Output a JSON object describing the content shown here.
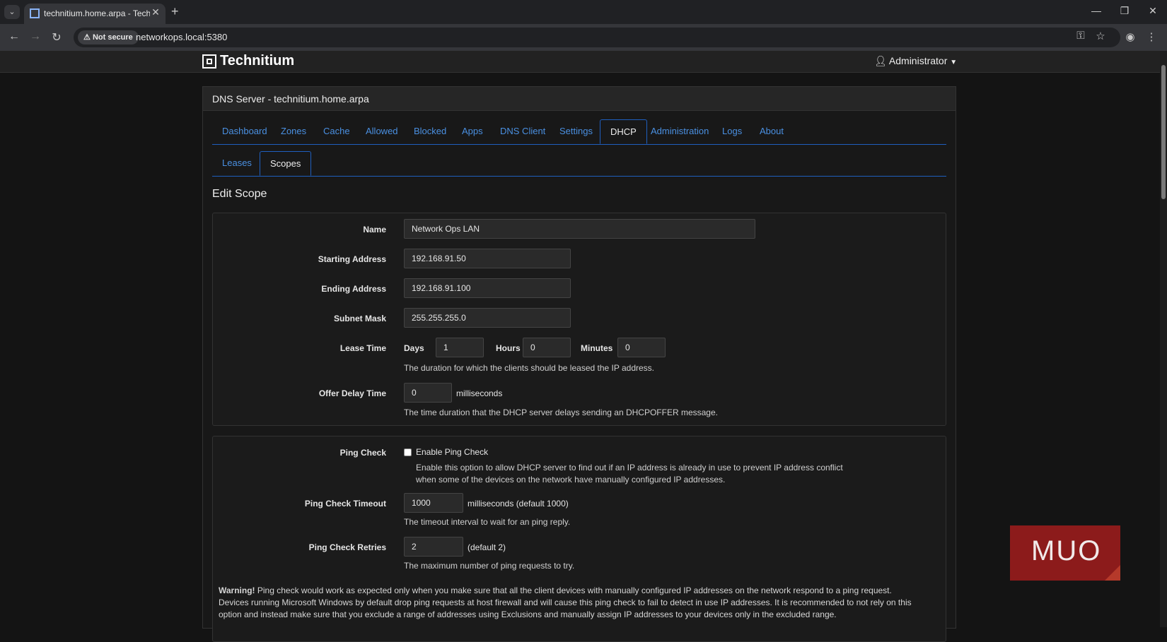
{
  "browser": {
    "tab_title": "technitium.home.arpa - Technitium",
    "security_label": "Not secure",
    "url": "networkops.local:5380"
  },
  "app": {
    "brand": "Technitium",
    "user": "Administrator",
    "panel_title": "DNS Server - technitium.home.arpa",
    "main_tabs": [
      {
        "label": "Dashboard"
      },
      {
        "label": "Zones"
      },
      {
        "label": "Cache"
      },
      {
        "label": "Allowed"
      },
      {
        "label": "Blocked"
      },
      {
        "label": "Apps"
      },
      {
        "label": "DNS Client"
      },
      {
        "label": "Settings"
      },
      {
        "label": "DHCP"
      },
      {
        "label": "Administration"
      },
      {
        "label": "Logs"
      },
      {
        "label": "About"
      }
    ],
    "active_main_tab": "DHCP",
    "sub_tabs": [
      {
        "label": "Leases"
      },
      {
        "label": "Scopes"
      }
    ],
    "active_sub_tab": "Scopes",
    "section_title": "Edit Scope"
  },
  "form": {
    "name": {
      "label": "Name",
      "value": "Network Ops LAN"
    },
    "starting_address": {
      "label": "Starting Address",
      "value": "192.168.91.50"
    },
    "ending_address": {
      "label": "Ending Address",
      "value": "192.168.91.100"
    },
    "subnet_mask": {
      "label": "Subnet Mask",
      "value": "255.255.255.0"
    },
    "lease_time": {
      "label": "Lease Time",
      "days_label": "Days",
      "days": "1",
      "hours_label": "Hours",
      "hours": "0",
      "minutes_label": "Minutes",
      "minutes": "0",
      "help": "The duration for which the clients should be leased the IP address."
    },
    "offer_delay": {
      "label": "Offer Delay Time",
      "value": "0",
      "unit": "milliseconds",
      "help": "The time duration that the DHCP server delays sending an DHCPOFFER message."
    },
    "ping_check": {
      "label": "Ping Check",
      "checkbox_label": "Enable Ping Check",
      "checked": false,
      "help": "Enable this option to allow DHCP server to find out if an IP address is already in use to prevent IP address conflict when some of the devices on the network have manually configured IP addresses."
    },
    "ping_timeout": {
      "label": "Ping Check Timeout",
      "value": "1000",
      "unit": "milliseconds (default 1000)",
      "help": "The timeout interval to wait for an ping reply."
    },
    "ping_retries": {
      "label": "Ping Check Retries",
      "value": "2",
      "unit": "(default 2)",
      "help": "The maximum number of ping requests to try."
    },
    "warning_title": "Warning!",
    "warning_text": " Ping check would work as expected only when you make sure that all the client devices with manually configured IP addresses on the network respond to a ping request. Devices running Microsoft Windows by default drop ping requests at host firewall and will cause this ping check to fail to detect in use IP addresses. It is recommended to not rely on this option and instead make sure that you exclude a range of addresses using Exclusions and manually assign IP addresses to your devices only in the excluded range."
  },
  "watermark": "MUO",
  "colors": {
    "accent": "#4a90e2",
    "tab_border": "#1f5fbf",
    "watermark": "#8c1b1b"
  }
}
